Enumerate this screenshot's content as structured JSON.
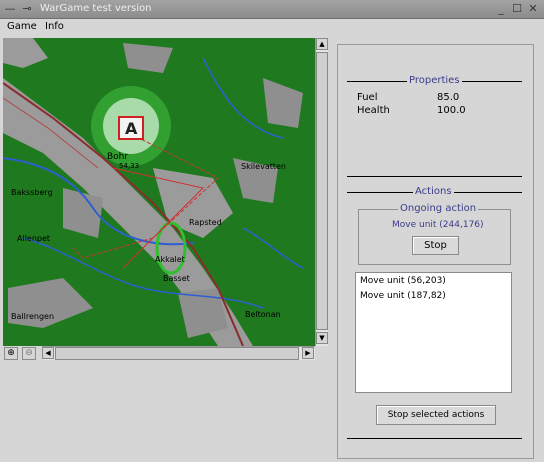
{
  "window": {
    "title": "WarGame test version",
    "controls": {
      "minimize": "_",
      "maximize": "☐",
      "close": "✕"
    }
  },
  "menu": {
    "items": [
      "Game",
      "Info"
    ]
  },
  "map": {
    "unit_label": "A",
    "places": [
      "Bohr",
      "Skilevatten",
      "Rapsted",
      "Bakssberg",
      "Allenpet",
      "Ballrengen",
      "Akkalet",
      "Beltonan",
      "Basset"
    ],
    "elevation": "54,33"
  },
  "zoom": {
    "in": "⊕",
    "out": "⊖"
  },
  "properties": {
    "title": "Properties",
    "rows": [
      {
        "label": "Fuel",
        "value": "85.0"
      },
      {
        "label": "Health",
        "value": "100.0"
      }
    ]
  },
  "actions": {
    "title": "Actions",
    "ongoing_title": "Ongoing action",
    "ongoing_text": "Move unit (244,176)",
    "stop_label": "Stop",
    "list": [
      "Move unit (56,203)",
      "Move unit (187,82)"
    ],
    "stop_selected_label": "Stop selected actions"
  },
  "colors": {
    "forest": "#1f7a1f",
    "open_land": "#9b9b9b",
    "water": "#2e5fd0",
    "accent_title": "#3b3b8c",
    "road": "#8b2c2c"
  }
}
